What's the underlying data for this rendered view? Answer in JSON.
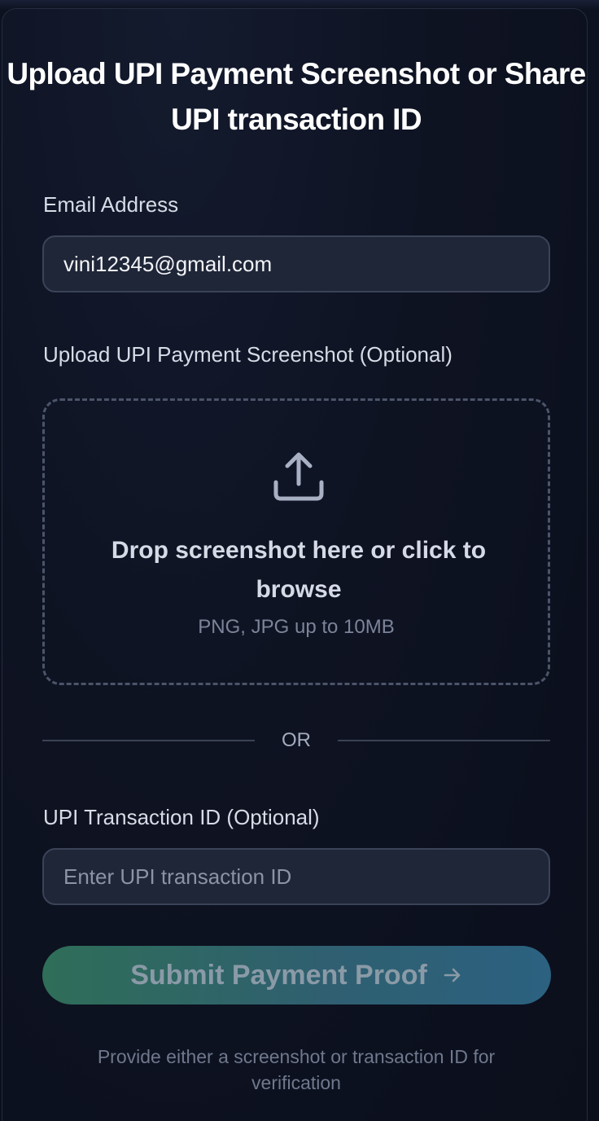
{
  "form": {
    "title": "Upload UPI Payment Screenshot or Share UPI transaction ID",
    "email": {
      "label": "Email Address",
      "value": "vini12345@gmail.com"
    },
    "upload": {
      "label": "Upload UPI Payment Screenshot (Optional)",
      "icon": "upload-icon",
      "prompt": "Drop screenshot here or click to browse",
      "hint": "PNG, JPG up to 10MB"
    },
    "divider_text": "OR",
    "transaction": {
      "label": "UPI Transaction ID (Optional)",
      "value": "",
      "placeholder": "Enter UPI transaction ID"
    },
    "submit": {
      "label": "Submit Payment Proof",
      "icon": "arrow-right-icon"
    },
    "footnote": "Provide either a screenshot or transaction ID for verification"
  },
  "colors": {
    "background": "#0b0f1c",
    "input_background": "#1f2637",
    "button_gradient_start": "#2f6e58",
    "button_gradient_end": "#2c6180"
  }
}
